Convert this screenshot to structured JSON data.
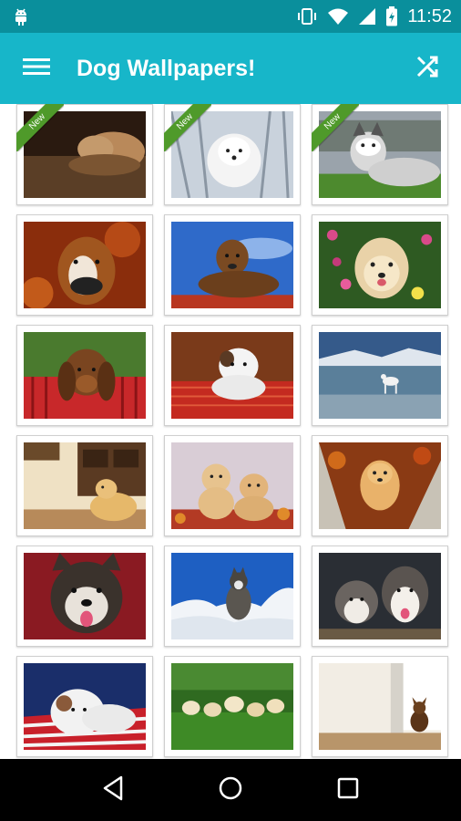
{
  "status_bar": {
    "time": "11:52",
    "icons": [
      "android-robot-icon",
      "vibrate-icon",
      "wifi-icon",
      "signal-icon",
      "battery-charging-icon"
    ]
  },
  "app_bar": {
    "title": "Dog Wallpapers!",
    "menu_icon": "menu-icon",
    "shuffle_icon": "shuffle-icon"
  },
  "badge_text": "New",
  "wallpapers": [
    {
      "name": "shar-pei-on-couch",
      "is_new": true
    },
    {
      "name": "samoyed-in-snow",
      "is_new": true
    },
    {
      "name": "husky-standing",
      "is_new": true
    },
    {
      "name": "boxer-autumn",
      "is_new": false
    },
    {
      "name": "terrier-lying-blue-sky",
      "is_new": false
    },
    {
      "name": "yorkie-with-flowers",
      "is_new": false
    },
    {
      "name": "bloodhound-puppy-fence",
      "is_new": false
    },
    {
      "name": "bulldog-puppy-blanket",
      "is_new": false
    },
    {
      "name": "dalmatian-on-beach",
      "is_new": false
    },
    {
      "name": "golden-puppy-in-room",
      "is_new": false
    },
    {
      "name": "two-golden-puppies",
      "is_new": false
    },
    {
      "name": "golden-puppy-in-tree",
      "is_new": false
    },
    {
      "name": "malamute-puppy-face",
      "is_new": false
    },
    {
      "name": "husky-puppy-snow",
      "is_new": false
    },
    {
      "name": "two-husky-puppies",
      "is_new": false
    },
    {
      "name": "bulldog-flag-blanket",
      "is_new": false
    },
    {
      "name": "puppies-on-grass",
      "is_new": false
    },
    {
      "name": "chihuahua-by-window",
      "is_new": false
    }
  ],
  "nav_bar": {
    "icons": [
      "back-icon",
      "home-icon",
      "recents-icon"
    ]
  },
  "colors": {
    "status_bar": "#0a8f9c",
    "app_bar": "#17b6c9",
    "new_badge": "#4f9a2a"
  }
}
